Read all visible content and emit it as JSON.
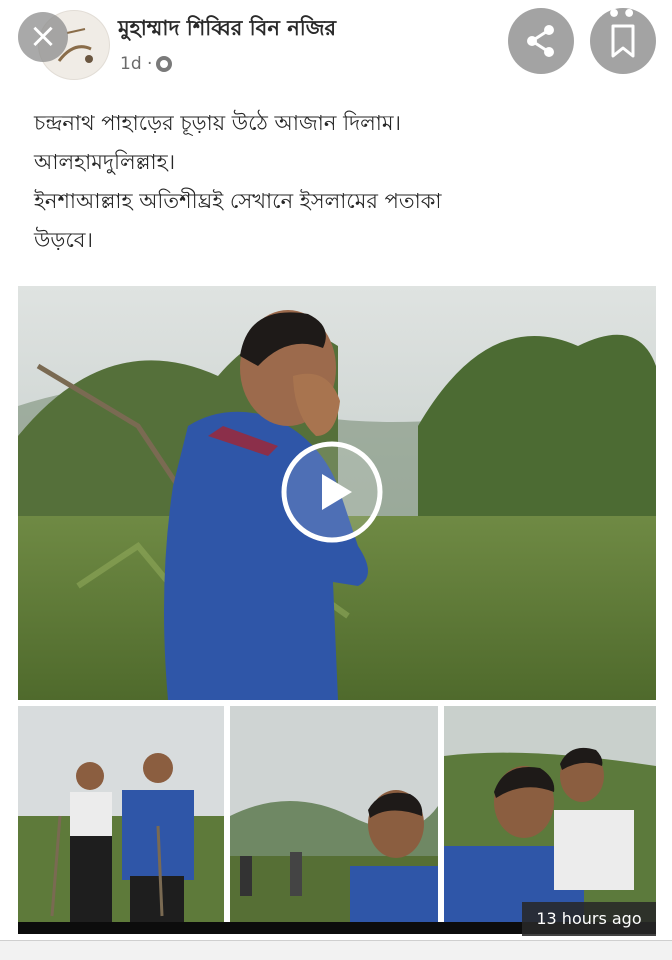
{
  "header": {
    "close_icon": "×",
    "author_name": "মুহাম্মাদ শিব্বির বিন নজির",
    "time_label": "1d ·",
    "privacy_icon": "globe-icon",
    "share_icon": "share-icon",
    "save_icon": "bookmark-icon",
    "more_icon": "•••"
  },
  "post": {
    "lines": [
      "চন্দ্রনাথ পাহাড়ের চূড়ায় উঠে আজান দিলাম।",
      "আলহামদুলিল্লাহ।",
      "ইনশাআল্লাহ অতিশীঘ্রই সেখানে ইসলামের পতাকা",
      "উড়বে।"
    ]
  },
  "media": {
    "main_video_play_icon": "play-icon",
    "thumbnails": [
      "photo-two-men-hiking",
      "photo-group-hilltop",
      "photo-selfie-two-men"
    ]
  },
  "timestamp_overlay": "13 hours ago",
  "colors": {
    "sky": "#cfd6d6",
    "foliage": "#5f7f3a",
    "shirt_blue": "#2f56a8",
    "overlay_gray": "#8c8c8c"
  }
}
